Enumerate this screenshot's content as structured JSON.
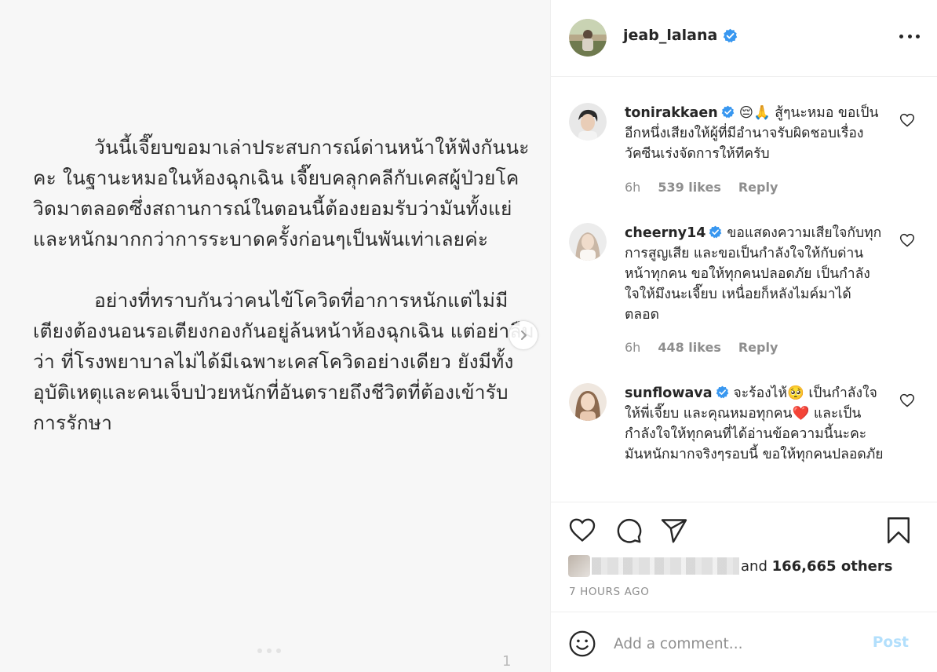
{
  "post": {
    "paragraphs": [
      "วันนี้เจี๊ยบขอมาเล่าประสบการณ์ด่านหน้าให้ฟังกันนะคะ ในฐานะหมอในห้องฉุกเฉิน เจี๊ยบคลุกคลีกับเคสผู้ป่วยโควิดมาตลอดซึ่งสถานการณ์ในตอนนี้ต้องยอมรับว่ามันทั้งแย่และหนักมากกว่าการระบาดครั้งก่อนๆเป็นพันเท่าเลยค่ะ",
      "อย่างที่ทราบกันว่าคนไข้โควิดที่อาการหนักแต่ไม่มีเตียงต้องนอนรอเตียงกองกันอยู่ล้นหน้าห้องฉุกเฉิน แต่อย่าลืมว่า ที่โรงพยาบาลไม่ได้มีเฉพาะเคสโควิดอย่างเดียว ยังมีทั้งอุบัติเหตุและคนเจ็บป่วยหนักที่อันตรายถึงชีวิตที่ต้องเข้ารับการรักษา"
    ],
    "page_number": "1",
    "next_icon": "chevron-right-icon"
  },
  "owner": {
    "username": "jeab_lalana",
    "verified_icon": "verified-badge-icon",
    "more_icon": "more-options-icon"
  },
  "comments": [
    {
      "username": "tonirakkaen",
      "text": "😔🙏 สู้ๆนะหมอ ขอเป็นอีกหนึ่งเสียงให้ผู้ที่มีอำนาจรับผิดชอบเรื่องวัคซีนเร่งจัดการให้ทีครับ",
      "time": "6h",
      "likes": "539 likes",
      "reply": "Reply"
    },
    {
      "username": "cheerny14",
      "text": "ขอแสดงความเสียใจกับทุกการสูญเสีย และขอเป็นกำลังใจให้กับด่านหน้าทุกคน ขอให้ทุกคนปลอดภัย เป็นกำลังใจให้มึงนะเจี๊ยบ เหนื่อยก็หลังไมค์มาได้ตลอด",
      "time": "6h",
      "likes": "448 likes",
      "reply": "Reply"
    },
    {
      "username": "sunflowava",
      "text": "จะร้องไห้🥺 เป็นกำลังใจให้พี่เจี๊ยบ และคุณหมอทุกคน❤️ และเป็นกำลังใจให้ทุกคนที่ได้อ่านข้อความนี้นะคะ มันหนักมากจริงๆรอบนี้ ขอให้ทุกคนปลอดภัย"
    }
  ],
  "actions": {
    "like_icon": "heart-icon",
    "comment_icon": "comment-icon",
    "share_icon": "share-icon",
    "save_icon": "bookmark-icon"
  },
  "likes_summary": {
    "prefix": "and ",
    "count": "166,665 others"
  },
  "timestamp": "7 HOURS AGO",
  "comment_box": {
    "placeholder": "Add a comment...",
    "post_label": "Post",
    "emoji_icon": "emoji-icon"
  },
  "colors": {
    "verified": "#3897f0",
    "post_button_disabled": "#b2dffc",
    "meta_text": "#8e8e8e",
    "text": "#262626",
    "heart_red": "#ed4956"
  }
}
